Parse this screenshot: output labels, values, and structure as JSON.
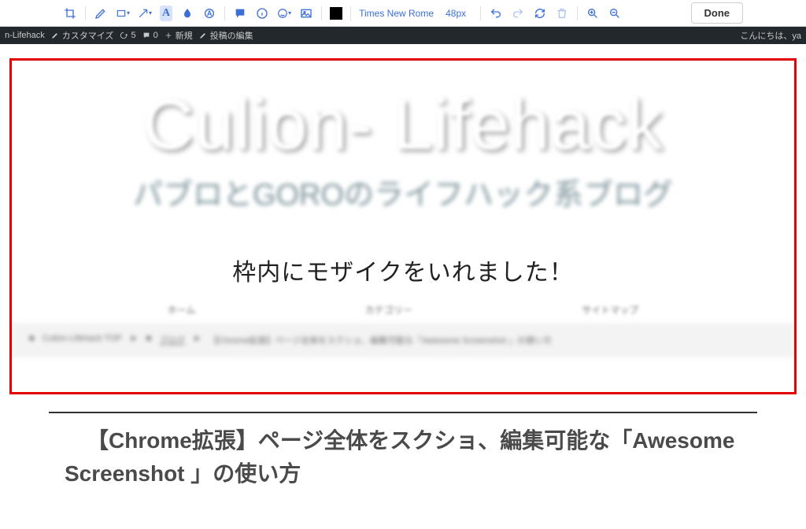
{
  "toolbar": {
    "font": "Times New Rome",
    "size": "48px",
    "done": "Done",
    "swatch": "#000000",
    "icons": {
      "crop": "crop-icon",
      "pen": "pen-icon",
      "rect": "rectangle-icon",
      "arrow": "arrow-icon",
      "text": "text-icon",
      "blur": "blur-icon",
      "badge": "badge-icon",
      "comment": "comment-icon",
      "info": "info-icon",
      "emoji": "emoji-icon",
      "image": "image-icon",
      "undo": "undo-icon",
      "redo": "redo-icon",
      "refresh": "refresh-icon",
      "trash": "trash-icon",
      "zoom_in": "zoom-in-icon",
      "zoom_out": "zoom-out-icon"
    }
  },
  "wp_bar": {
    "site": "n-Lifehack",
    "customize": "カスタマイズ",
    "updates": "5",
    "comments": "0",
    "new": "新規",
    "edit": "投稿の編集",
    "greeting": "こんにちは、ya"
  },
  "hero": {
    "title": "Culion- Lifehack",
    "subtitle": "パブロとGOROのライフハック系ブログ"
  },
  "annotation": "枠内にモザイクをいれました！",
  "nav": {
    "home": "ホーム",
    "category": "カテゴリー",
    "sitemap": "サイトマップ"
  },
  "breadcrumb": {
    "top": "Culion-Lifehack TOP",
    "blog": "ブログ",
    "post": "【Chrome拡張】ページ全体をスクショ、編集可能な「Awesome Screenshot 」の使い方"
  },
  "article": {
    "title": "【Chrome拡張】ページ全体をスクショ、編集可能な「Awesome Screenshot 」の使い方"
  }
}
